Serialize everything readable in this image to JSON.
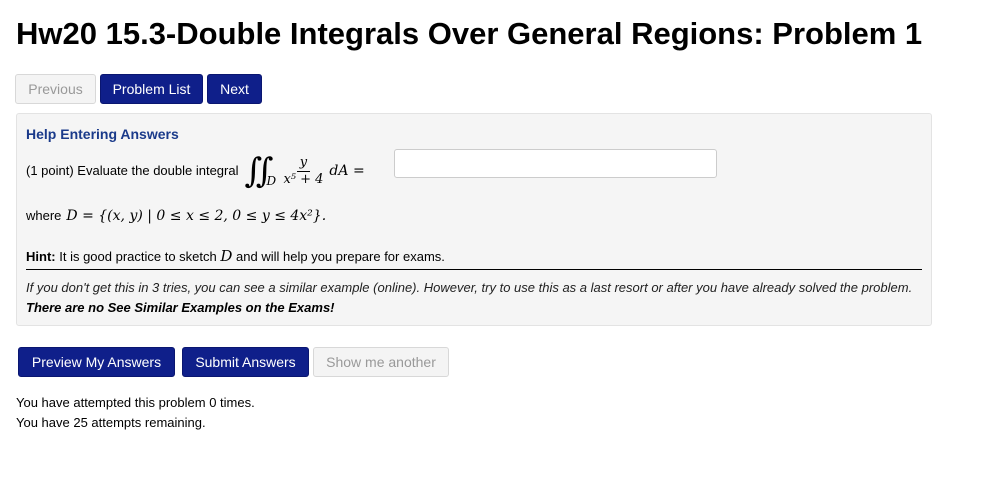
{
  "page_title": "Hw20 15.3-Double Integrals Over General Regions: Problem 1",
  "nav": {
    "previous_label": "Previous",
    "problem_list_label": "Problem List",
    "next_label": "Next"
  },
  "problem": {
    "help_link": "Help Entering Answers",
    "prompt": "(1 point) Evaluate the double integral",
    "integral_symbol": "∬",
    "integral_region": "D",
    "numerator": "y",
    "denominator": "x⁵ + 4",
    "differential": "dA =",
    "answer_value": "",
    "where_prefix": "where",
    "region_definition": "D = {(x, y) | 0 ≤ x ≤ 2,  0 ≤ y ≤ 4x²}.",
    "hint_label": "Hint:",
    "hint_text_before": "It is good practice to sketch",
    "hint_variable": "D",
    "hint_text_after": "and will help you prepare for exams.",
    "note_text": "If you don't get this in 3 tries, you can see a similar example (online). However, try to use this as a last resort or after you have already solved the problem.",
    "note_bold": "There are no See Similar Examples on the Exams!"
  },
  "actions": {
    "preview_label": "Preview My Answers",
    "submit_label": "Submit Answers",
    "show_another_label": "Show me another"
  },
  "status": {
    "attempted": "You have attempted this problem 0 times.",
    "remaining": "You have 25 attempts remaining."
  },
  "colors": {
    "primary_button": "#0f1f8a",
    "help_link": "#1a3a8a",
    "problem_background": "#f5f5f5"
  }
}
